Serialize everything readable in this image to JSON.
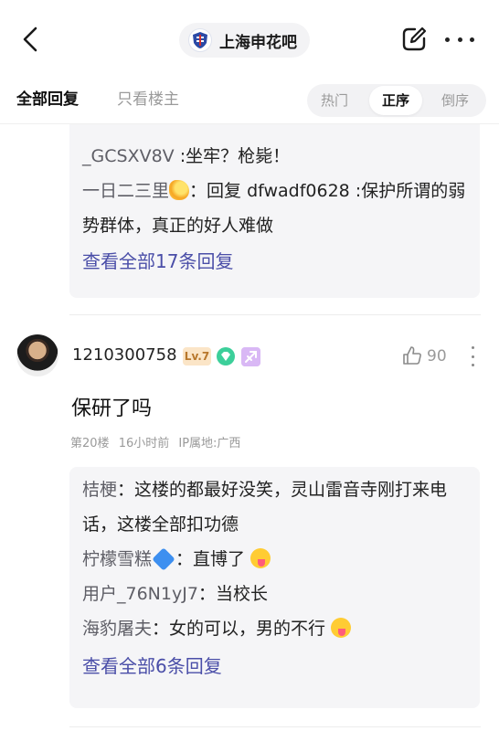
{
  "header": {
    "forum_name": "上海申花吧",
    "back_icon": "chevron-left-icon",
    "edit_icon": "edit-icon",
    "more_icon": "more-icon"
  },
  "tabs": {
    "all": "全部回复",
    "owner_only": "只看楼主",
    "sort": [
      "热门",
      "正序",
      "倒序"
    ],
    "selected_sort": "正序"
  },
  "top_replies": {
    "lines": [
      {
        "name": "_GCSXV8V",
        "sep": " :",
        "text": "坐牢？枪毙！"
      },
      {
        "name": "一日二三里",
        "emoji": "sparkle",
        "sep": "：",
        "text": "回复 dfwadf0628 :保护所谓的弱势群体，真正的好人难做"
      }
    ],
    "view_all": "查看全部17条回复"
  },
  "post": {
    "username": "1210300758",
    "level": "Lv.7",
    "likes": "90",
    "content": "保研了吗",
    "floor": "第20楼",
    "time": "16小时前",
    "ip": "IP属地:广西",
    "replies": [
      {
        "name": "桔梗",
        "sep": "：",
        "text": "这楼的都最好没笑，灵山雷音寺刚打来电话，这楼全部扣功德"
      },
      {
        "name": "柠檬雪糕",
        "sep": "：",
        "text": "直博了"
      },
      {
        "name": "用户_76N1yJ7",
        "sep": "：",
        "text": "当校长"
      },
      {
        "name": "海豹屠夫",
        "sep": "：",
        "text": "女的可以，男的不行"
      }
    ],
    "view_all": "查看全部6条回复"
  },
  "colors": {
    "link": "#4a4ea8",
    "reply_bg": "#f5f5f7",
    "level_bg": "#fbe5c7",
    "level_text": "#b8772c"
  }
}
